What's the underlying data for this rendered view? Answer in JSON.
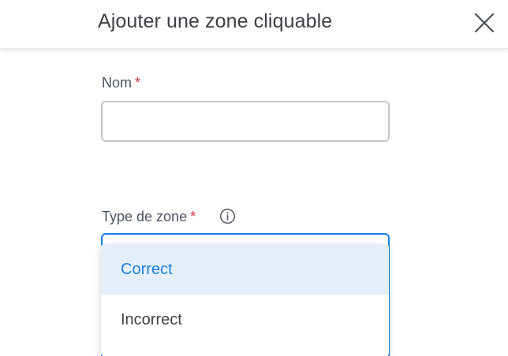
{
  "header": {
    "title": "Ajouter une zone cliquable",
    "close_icon": "close-icon"
  },
  "form": {
    "name_field": {
      "label": "Nom",
      "required_marker": "*",
      "value": "",
      "placeholder": ""
    },
    "zone_type_field": {
      "label": "Type de zone",
      "required_marker": "*",
      "info_icon": "info-icon",
      "options": [
        "Correct",
        "Incorrect"
      ],
      "highlighted_option": "Correct"
    }
  },
  "colors": {
    "accent": "#1a7fe0",
    "required": "#d6303b",
    "highlight_bg": "#e4effb"
  }
}
